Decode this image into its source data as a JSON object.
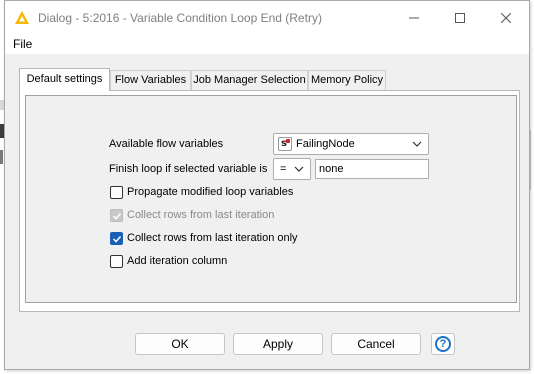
{
  "window": {
    "title": "Dialog - 5:2016 - Variable Condition Loop End (Retry)",
    "icon": "knime-warning-triangle-icon",
    "accent_color": "#f5b800"
  },
  "menu": {
    "file": "File"
  },
  "tabs": [
    {
      "label": "Default settings",
      "active": true
    },
    {
      "label": "Flow Variables",
      "active": false
    },
    {
      "label": "Job Manager Selection",
      "active": false
    },
    {
      "label": "Memory Policy",
      "active": false
    }
  ],
  "settings": {
    "available_label": "Available flow variables",
    "available_value": "FailingNode",
    "finish_label": "Finish loop if selected variable is",
    "operator_value": "=",
    "compare_value": "none",
    "checkboxes": [
      {
        "label": "Propagate modified loop variables",
        "checked": false,
        "enabled": true
      },
      {
        "label": "Collect rows from last iteration",
        "checked": true,
        "enabled": false
      },
      {
        "label": "Collect rows from last iteration only",
        "checked": true,
        "enabled": true
      },
      {
        "label": "Add iteration column",
        "checked": false,
        "enabled": true
      }
    ]
  },
  "buttons": {
    "ok": "OK",
    "apply": "Apply",
    "cancel": "Cancel",
    "help": "?"
  },
  "colors": {
    "checkbox_checked": "#1a5fb4",
    "help_blue": "#1a73c7",
    "flow_var_red": "#d02020"
  }
}
